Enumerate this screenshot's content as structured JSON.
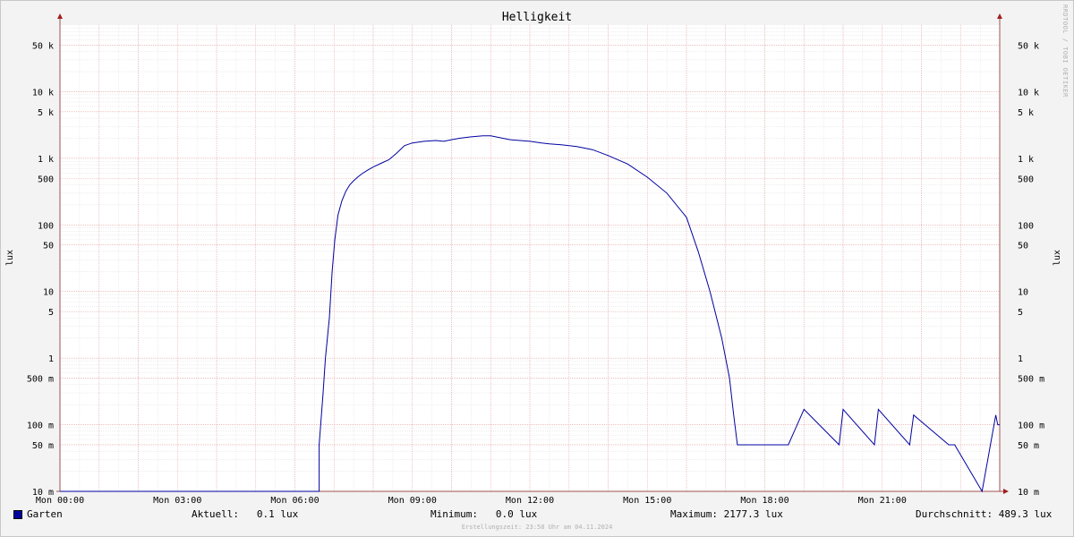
{
  "chart_data": {
    "type": "line",
    "title": "Helligkeit",
    "ylabel": "lux",
    "y_scale": "log",
    "ylim": [
      0.01,
      100000
    ],
    "xlim": [
      0,
      24
    ],
    "x_tick_labels": [
      "Mon 00:00",
      "Mon 03:00",
      "Mon 06:00",
      "Mon 09:00",
      "Mon 12:00",
      "Mon 15:00",
      "Mon 18:00",
      "Mon 21:00"
    ],
    "x_tick_hours": [
      0,
      3,
      6,
      9,
      12,
      15,
      18,
      21
    ],
    "y_tick_labels": [
      "10 m",
      "50 m",
      "100 m",
      "500 m",
      "1",
      "5",
      "10",
      "50",
      "100",
      "500",
      "1 k",
      "5 k",
      "10 k",
      "50 k"
    ],
    "y_tick_values": [
      0.01,
      0.05,
      0.1,
      0.5,
      1,
      5,
      10,
      50,
      100,
      500,
      1000,
      5000,
      10000,
      50000
    ],
    "grid": true,
    "legend_position": "bottom-left",
    "series": [
      {
        "name": "Garten",
        "color": "#0000a0",
        "x": [
          0,
          6.62,
          6.62,
          6.72,
          6.78,
          6.88,
          6.95,
          7.02,
          7.1,
          7.2,
          7.3,
          7.4,
          7.5,
          7.6,
          7.7,
          7.85,
          8.0,
          8.2,
          8.4,
          8.6,
          8.8,
          9.0,
          9.3,
          9.6,
          9.8,
          10.0,
          10.2,
          10.5,
          10.8,
          11.0,
          11.5,
          12.0,
          12.3,
          12.5,
          12.8,
          13.2,
          13.6,
          14.0,
          14.5,
          15.0,
          15.5,
          16.0,
          16.3,
          16.6,
          16.9,
          17.1,
          17.2,
          17.3,
          17.4,
          17.5,
          17.6,
          17.7,
          17.8,
          17.85,
          17.9,
          18.2,
          18.2,
          18.6,
          18.6,
          19.0,
          19.0,
          19.9,
          19.9,
          20.0,
          20.0,
          20.8,
          20.8,
          20.9,
          20.9,
          21.7,
          21.7,
          21.8,
          21.8,
          22.7,
          22.7,
          22.85,
          22.85,
          23.55,
          23.55,
          23.9,
          23.9,
          23.95,
          23.95,
          24.0
        ],
        "y": [
          0.01,
          0.01,
          0.05,
          0.3,
          1,
          4,
          20,
          60,
          140,
          230,
          320,
          400,
          460,
          520,
          580,
          660,
          740,
          840,
          950,
          1200,
          1550,
          1700,
          1800,
          1850,
          1800,
          1900,
          2000,
          2100,
          2177.3,
          2177.3,
          1900,
          1800,
          1700,
          1650,
          1600,
          1500,
          1350,
          1100,
          820,
          520,
          300,
          130,
          40,
          10,
          2,
          0.5,
          0.15,
          0.05,
          0.05,
          0.05,
          0.05,
          0.05,
          0.05,
          0.05,
          0.05,
          0.05,
          0.05,
          0.05,
          0.05,
          0.17,
          0.17,
          0.05,
          0.05,
          0.17,
          0.17,
          0.05,
          0.05,
          0.17,
          0.17,
          0.05,
          0.05,
          0.14,
          0.14,
          0.05,
          0.05,
          0.05,
          0.05,
          0.01,
          0.01,
          0.14,
          0.14,
          0.1,
          0.1,
          0.1
        ]
      }
    ]
  },
  "credit": "RRDTOOL / TOBI OETIKER",
  "legend": {
    "series_name": "Garten",
    "current": "Aktuell:   0.1 lux",
    "minimum": "Minimum:   0.0 lux",
    "maximum": "Maximum: 2177.3 lux",
    "average": "Durchschnitt: 489.3 lux"
  },
  "footer": "Erstellungszeit: 23:58 Uhr am 04.11.2024"
}
